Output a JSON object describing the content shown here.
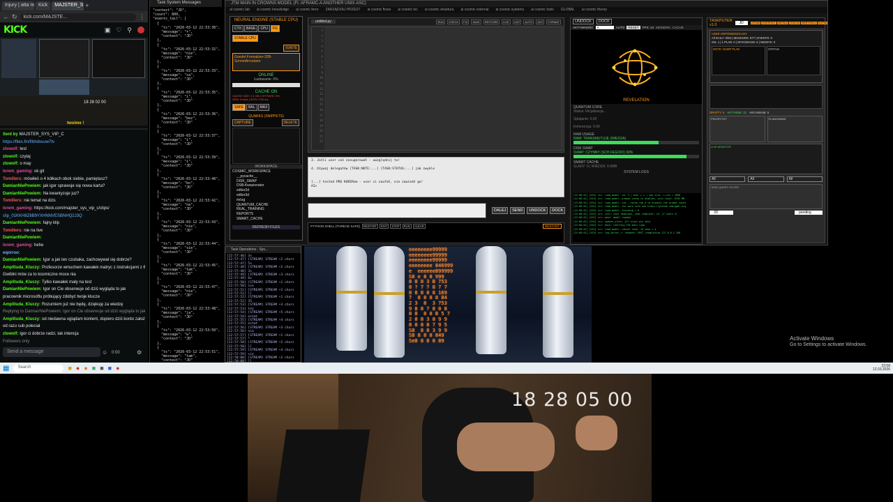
{
  "browser": {
    "tabs": [
      "Injury | atta m",
      "Kick",
      "MAJSTER_S"
    ],
    "url": "kick.com/MAJSTE...",
    "logo": "KICK",
    "video_time": "18 28 02 00",
    "overlay_label": "twoime !",
    "chat_lines": [
      {
        "user": "Sent by",
        "text": "MAJSTER_SYS_VIP_C",
        "color": "#53fc18"
      },
      {
        "user": "",
        "text": "https://files.fm/f/bhdvuuw7tv",
        "color": "#6ab4ff"
      },
      {
        "user": "zlowolf:",
        "text": "test",
        "color": "#e24c9c"
      },
      {
        "user": "zlowolf:",
        "text": "czytaj",
        "color": "#53fc18"
      },
      {
        "user": "zlowolf:",
        "text": "o may",
        "color": "#53fc18"
      },
      {
        "user": "lorem_gaming:",
        "text": "ok git",
        "color": "#e24c9c"
      },
      {
        "user": "Tomillers:",
        "text": "mówiłeś o 4 kółkach obok siebie, pamiętasz?",
        "color": "#ff5555"
      },
      {
        "user": "DamianNiePowiem:",
        "text": "jak igor sprawuje się nowa karta?",
        "color": "#53fc18"
      },
      {
        "user": "DamianNiePowiem:",
        "text": "Na kwantyzuje juz?",
        "color": "#53fc18"
      },
      {
        "user": "Tomillers:",
        "text": "nie temat na dzis",
        "color": "#ff5555"
      },
      {
        "user": "lorem_gaming:",
        "text": "https://kick.com/majster_sys_vip_c/clips/",
        "color": "#e24c9c"
      },
      {
        "user": "",
        "text": "clip_01KKH8Z6B9YXHNNVESBNHQ2J3Q",
        "color": "#6ab4ff"
      },
      {
        "user": "DamianNiePowiem:",
        "text": "fajny klip",
        "color": "#53fc18"
      },
      {
        "user": "Tomillers:",
        "text": "nie na live",
        "color": "#ff5555"
      },
      {
        "user": "DamianNiePowiem:",
        "text": "",
        "color": "#53fc18"
      },
      {
        "user": "lorem_gaming:",
        "text": "hehe",
        "color": "#e24c9c"
      },
      {
        "user": "eqorroo:",
        "text": "",
        "color": "#6ab4ff"
      },
      {
        "user": "DamianNiePowiem:",
        "text": "Igor a jak ten czubaka, zachowywał się dobrze?",
        "color": "#53fc18"
      },
      {
        "user": "Amplituda_Kluczy:",
        "text": "Profesorze wmuchem kawałek matryc z instrukcjami z 6 i 8 i",
        "color": "#53fc18"
      },
      {
        "user": "",
        "text": "Gwiblni mów za to kosmiczne moce nia",
        "color": "#e6e6e6"
      },
      {
        "user": "Amplituda_Kluczy:",
        "text": "Tylko kawałek mały na test",
        "color": "#53fc18"
      },
      {
        "user": "DamianNiePowiem:",
        "text": "Igor on Cie obserwuje od dziś wygląda to jak",
        "color": "#53fc18"
      },
      {
        "user": "",
        "text": "pracownik microsoftu próbujący zdobyć twoje klucze",
        "color": "#e6e6e6"
      },
      {
        "user": "Amplituda_Kluczy:",
        "text": "Rozumiem już nie będę, dziękuję za wiedzę",
        "color": "#53fc18"
      },
      {
        "user": "",
        "text": "Replying to DamianNiePowiem: Igor on Cie obserwuje od dziś wygląda to jak pracownik m...",
        "color": "#888888"
      },
      {
        "user": "Amplituda_Kluczy:",
        "text": "od niedawna oglądam kontent, dopiero dziś konto założyłem i",
        "color": "#53fc18"
      },
      {
        "user": "",
        "text": "od razu sub poleciał",
        "color": "#e6e6e6"
      },
      {
        "user": "zlowolf:",
        "text": "igor ci dobrze radzi, tak intencja",
        "color": "#53fc18"
      },
      {
        "user": "",
        "text": "Followers only",
        "color": "#888888"
      }
    ],
    "chat_placeholder": "Send a message",
    "chat_timer": "0:00"
  },
  "sysmsg": {
    "title": "Task System Messages",
    "log": "\"context\": \"JD\",\n\"count\": 800,\n\"events_tail\": [\n  {\n    \"ts\": \"2026-03-12 22:53:30\",\n    \"message\": \"+\",\n    \"context\": \"JD\"\n  },\n  {\n    \"ts\": \"2026-03-12 22:53:32\",\n    \"message\": \"nie\",\n    \"context\": \"JD\"\n  },\n  {\n    \"ts\": \"2026-03-12 22:53:33\",\n    \"message\": \"sa\",\n    \"context\": \"JD\"\n  },\n  {\n    \"ts\": \"2026-03-12 22:53:35\",\n    \"message\": \"i\",\n    \"context\": \"JD\"\n  },\n  {\n    \"ts\": \"2026-03-12 22:53:36\",\n    \"message\": \"bez\",\n    \"context\": \"JD\"\n  },\n  {\n    \"ts\": \"2026-03-12 22:53:37\",\n    \"message\": \"i\",\n    \"context\": \"JD\"\n  },\n  {\n    \"ts\": \"2026-03-12 22:53:39\",\n    \"message\": \"i\",\n    \"context\": \"JD\"\n  },\n  {\n    \"ts\": \"2026-03-12 22:53:40\",\n    \"message\": \"bo\",\n    \"context\": \"JD\"\n  },\n  {\n    \"ts\": \"2026-03-12 22:53:42\",\n    \"message\": \"na\",\n    \"context\": \"JD\"\n  },\n  {\n    \"ts\": \"2026-03-12 22:53:43\",\n    \"message\": \"nie\",\n    \"context\": \"JD\"\n  },\n  {\n    \"ts\": \"2026-03-12 22:53:44\",\n    \"message\": \"sie\",\n    \"context\": \"JD\"\n  },\n  {\n    \"ts\": \"2026-03-12 22:53:45\",\n    \"message\": \"tak\",\n    \"context\": \"JD\"\n  },\n  {\n    \"ts\": \"2026-03-12 22:53:47\",\n    \"message\": \"nie\",\n    \"context\": \"JD\"\n  },\n  {\n    \"ts\": \"2026-03-12 22:53:48\",\n    \"message\": \"ja\",\n    \"context\": \"JD\"\n  },\n  {\n    \"ts\": \"2026-03-12 22:53:50\",\n    \"message\": \"w\",\n    \"context\": \"JD\"\n  },\n  {\n    \"ts\": \"2026-03-12 22:53:51\",\n    \"message\": \"tam\",\n    \"context\": \"JD\"\n  },\n  {\n    \"ts\": \"2026-03-12 22:53:53\",\n    \"message\": \"w\",\n    \"context\": \"JD\"\n  },\n  {\n    \"ts\": \"2026-03-12 22:53:54\",\n    \"message\": \".\",\n    \"context\": \"JD\"\n  },\n  {\n    \"ts\": \"2026-03-12 22:53:55\",\n    \"message\": \"stro\",\n    \"context\": \"JD\"\n  }"
  },
  "app": {
    "title": "JTM MAIN IN CROWNS MODEL (Ft. AFRAMC-A ANOTHER UNIX-ASC)",
    "menu": [
      "ai cosmic lab",
      "ai cosmic knowledge",
      "ai cosmic ferro",
      "ZARZĄDZAJ PRZEST",
      "ai cosmic flows",
      "ai cosmic loc",
      "ai cosmic struktura",
      "ai cosmic external",
      "ai cosmic systems",
      "ai cosmic tools",
      "GLOBAL",
      "ai cosmic theory"
    ],
    "neural": {
      "title": "NEURAL ENGINE (STABLE CPU)",
      "buttons": [
        "CTX",
        "BASE",
        "CPU",
        "FG"
      ],
      "stable_cpu": "STABLE CPU",
      "ignite": "IGNITE",
      "model": "Goedel-Formalizer-32B-SonnetAnnotator",
      "online": "ONLINE",
      "load": "Ładowanie: 0%",
      "cache": "CACHE ON",
      "cache_lines": [
        "CACHE SIZE: 2.1 GB  |  HIT RATE: 0%",
        "GEN: 0 tok/s  |  WYS: 0.00 ms"
      ],
      "modes": [
        "SAFE",
        "BAL",
        "MAX"
      ],
      "quarks": "QUARKS (SNIPPETS)",
      "capture": "CAPTURE",
      "delete": "DELETE",
      "workspace": "WORKSPACE",
      "tree": [
        "COSMIC_WORKSPACE",
        "__pycache__",
        "DISK_SWAP",
        "DSB-Kwazionator",
        "editor2d",
        "editor3d",
        "mózg",
        "QUANTUM_CACHE",
        "REAL_TRAINING",
        "REPORTS",
        "SMART_CACHE"
      ],
      "refresh": "REFRESH FILES"
    },
    "editor": {
      "tab": "untitled.py",
      "toolbar": [
        "RUN",
        "CHECK",
        "FIX",
        "SAVE",
        "RESTORE",
        "LIVE",
        "LINT",
        "AUTO",
        "ANT",
        "FORMAT"
      ],
      "line_numbers": [
        "1",
        "2",
        "3",
        "4",
        "5",
        "6",
        "7",
        "8",
        "9",
        "10",
        "11",
        "12",
        "13",
        "14",
        "15",
        "16",
        "17",
        "18",
        "19",
        "20",
        "21",
        "22"
      ],
      "output_lines": [
        "3. Jeśli user coś zasugerował - uwzględnij to!",
        "",
        "4. Używaj delegatów [TASK:NOTE:...] [TASK:STATUS:...] jak zwykle",
        "",
        "",
        "[...]  tested PRO KODERem - user ci zaufał, nie zawiedź go!",
        "AI>"
      ],
      "send_buttons": [
        "DALEJ",
        "SEND",
        "UNDOCK",
        "DOCK"
      ],
      "shell_label": "PYTHON SHELL [THREAD SAFE]",
      "shell_buttons": [
        "RESTART",
        "EXIT",
        "STOP",
        "RUN",
        "CLEAR"
      ],
      "shell_reset": "RESTART"
    },
    "viz": {
      "undock": "UNDOCK",
      "dock": "DOCK",
      "activity_label": "AKTYWNOŚĆ",
      "activity_value": "A",
      "auto": "AUTO",
      "reset": "RESET",
      "fps": "FPS: 24",
      "modes": [
        "MODERN",
        "CACHE"
      ],
      "revelation": "REVELATION",
      "quantum_title": "QUANTUM CORE",
      "quantum_lines": [
        "Status: Inicjalizacja...",
        "Splątanie: 0.00",
        "Koherencja: 0.00"
      ],
      "ram_title": "RAM USAGE",
      "ram_status": "RAM: TRANSMUTUJE (WIEDZA)",
      "ram_fraction": 0.68,
      "swap_title": "DISK SWAP",
      "swap_status": "SWAP: CZYNNY (SCH.FEGOIO) 90%",
      "swap_fraction": 0.9,
      "smart_title": "SMART CACHE",
      "smart_status": "SLADY: 0  |  WIEDZA: 0.0MB",
      "logs_title": "SYSTEM LOGS",
      "logs": [
        "[22:08:42] [SSV] src: load_model: id: 3 | kod: c.c | new slot, c.ctx = 4096",
        "[22:08:42] [SSV] src: load_model: prompt cache is enabled, size limit: 8192 MB",
        "[22:08:42] [SSV] src: load_model: use --cache-ram 0 to disable the prompt cache",
        "[22:08:42] [SSV] src: load_model: for more info see https://github.com/ggml-org",
        "[22:08:42] [SSV] src: load_model: thinking = 0",
        "[22:08:42] [SSV] src: init: chat template, chat_template: (b: jf tools 5)",
        "[22:08:42] [SSV] src: main: model loaded",
        "[22:08:42] [SSV] src: update_slots: all slots are idle",
        "[22:08:42] [SSV] src: main: starting the main loop",
        "[22:08:42] [SSV] src: load_model: cancel task, id_task = 4",
        "[22:08:42] [SSV] src: log_server_r: request: POST /completion 127.0.0.1 200"
      ]
    },
    "taskputer": {
      "title": "TASKPUTER v1.0",
      "mode": "JD",
      "tabs": [
        "USTAW",
        "KONTEKST",
        "ZAPISUJ",
        "STATUS",
        "WERYFIKUJ",
        "ELIPSA"
      ],
      "user_label": "USER ODPOWIEDZIALNY",
      "stats": "All DAILY: 0/63  |  SESSIONS: 877  |  EVENTS: 0",
      "meta": "Ost. 1 | 1 PLAN: 0 | WYKONANO: 6 | NIEWYK: 0",
      "note_title": "NOTE: DUMP PLAN",
      "status_title": "STATUS",
      "drafts_label": "DRAFTY: 0",
      "aktywne_label": "AKTYWNE: 13",
      "archiwum_label": "ARCHIWUM: 5",
      "priority_label": "PRIORYTET",
      "planned_label": "PLANOWANE",
      "live_label": "LIVE MONITOR",
      "filters": [
        "All",
        "All",
        "All"
      ],
      "task_query": "TASK QUERY FILTER",
      "footer_mode": "JD",
      "footer_status": "pending"
    }
  },
  "taskops": {
    "title": "Task Operations - Sys...",
    "log": "[22:57:46] 3s\n[22:57:47] [STREAM] STREAM +2 chars\n[22:57:47] 5s\n[22:57:48] [STREAM] STREAM +2 chars\n[22:57:48] 3s\n[22:57:49] [STREAM] STREAM +3 chars\n[22:57:49] 6s\n[22:57:50] [STREAM] STREAM +1 chars\n[22:57:50] sie\n[22:57:51] [STREAM] STREAM +2 chars\n[22:57:51] ]]\n[22:57:52] [STREAM] STREAM +1 chars\n[22:57:52] 35\n[22:57:53] [STREAM] STREAM +3 chars\n[22:57:53] tez\n[22:57:54] [STREAM] STREAM +5 chars\n[22:57:54] ostat\n[22:57:55] [STREAM] STREAM +4 chars\n[22:57:55] ostat\n[22:57:56] [STREAM] STREAM +3 chars\n[22:57:56] nia\n[22:57:57] [STREAM] STREAM +1 chars\n[22:57:57] *\n[22:57:58] [STREAM] STREAM +2 chars\n[22:57:58] ]]\n[22:57:59] [STREAM] STREAM +4 chars\n[22:57:59] sie\n[22:58:00] [STREAM] STREAM +2 chars\n[22:58:00] ]]\n[22:58:01] [STREAM] STREAM +3 chars\n[22:58:01] wam\n[22:58:02] [STREAM] STREAM +1 chars\n[22:58:02] *\n[22:58:03] [STREAM] STREAM +2 chars"
  },
  "game": {
    "digits": "eeeeeeee99999\neeeeeeee99999\neeeeeeee99999\neeeeeeee 846999\ne  eeeeee899999\nS8 e 8 8 999\n8 8 8 3 B 753\n8 ? 7 7 8 7 7\n8 8 8 8 8 169\n7  8 8 8 8 84\n2 3  8  3 753\n9 8 8 7 8 0 8\n8 8  8 8 B 5 7\n2 8 8 3 8 9 9\n8 8 8 8 7 9 5\nS8  8 8 3 9 9\nS8 8 8 8 849\nSe8 8 8 8 89"
  },
  "desktop": {
    "activate_title": "Activate Windows",
    "activate_sub": "Go to Settings to activate Windows."
  },
  "taskbar": {
    "search": "Search",
    "time": "23:58",
    "date": "12.03.2026"
  },
  "cam": {
    "timestamp": "18 28 05 00"
  }
}
